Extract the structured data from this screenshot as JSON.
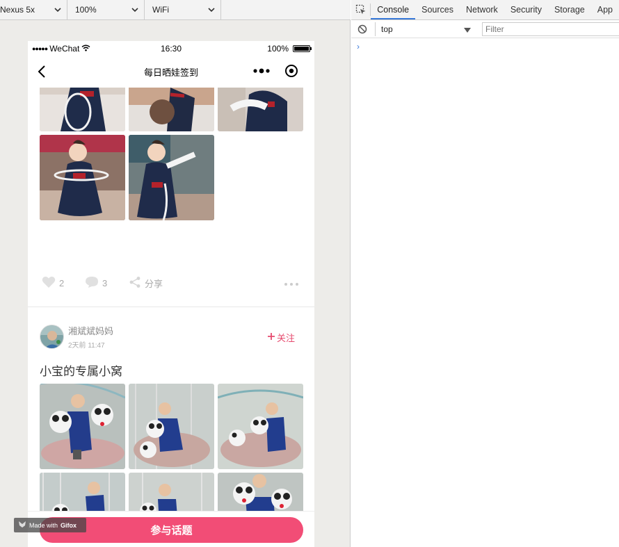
{
  "devbar": {
    "device": "Nexus 5x",
    "zoom": "100%",
    "network": "WiFi"
  },
  "phone": {
    "status": {
      "carrier": "WeChat",
      "time": "16:30",
      "battery": "100%"
    },
    "nav": {
      "title": "每日晒娃签到"
    },
    "post1": {
      "likes": "2",
      "comments": "3",
      "share_label": "分享"
    },
    "post2": {
      "author": "湘斌斌妈妈",
      "time": "2天前 11:47",
      "follow_label": "关注",
      "title": "小宝的专属小窝"
    },
    "join_button": "参与话题",
    "watermark": {
      "prefix": "Made with",
      "brand": "Gifox"
    }
  },
  "devtools": {
    "tabs": [
      "Console",
      "Sources",
      "Network",
      "Security",
      "Storage",
      "App"
    ],
    "active_tab": "Console",
    "context": "top",
    "filter_placeholder": "Filter",
    "prompt": "›"
  },
  "colors": {
    "accent": "#f24d76",
    "follow": "#e64a6e",
    "devtools_blue": "#3879d9"
  }
}
